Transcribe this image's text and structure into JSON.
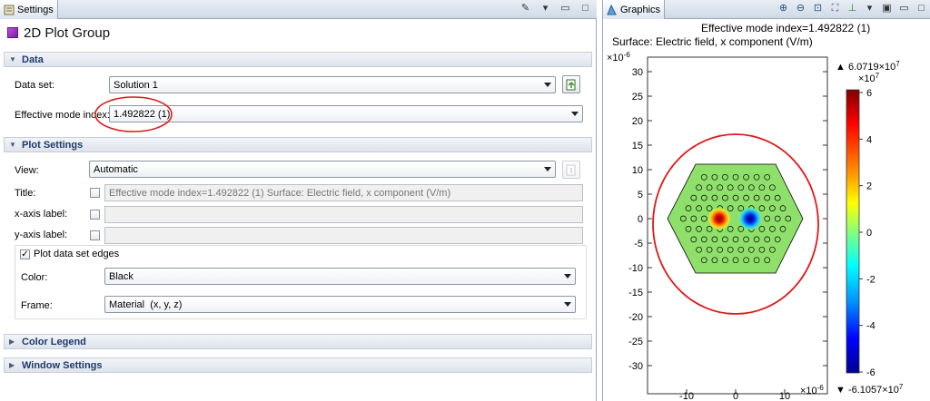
{
  "settings": {
    "tab_label": "Settings",
    "header_title": "2D Plot Group",
    "data_section": {
      "title": "Data",
      "dataset_label": "Data set:",
      "dataset_value": "Solution 1",
      "mode_index_label": "Effective mode index:",
      "mode_index_value": "1.492822 (1)"
    },
    "plot_settings": {
      "title": "Plot Settings",
      "view_label": "View:",
      "view_value": "Automatic",
      "title_label": "Title:",
      "title_value": "Effective mode index=1.492822 (1) Surface: Electric field, x component (V/m)",
      "xaxis_label": "x-axis label:",
      "xaxis_value": "",
      "yaxis_label": "y-axis label:",
      "yaxis_value": "",
      "edges_label": "Plot data set edges",
      "edges_checked": true,
      "color_label": "Color:",
      "color_value": "Black",
      "frame_label": "Frame:",
      "frame_value": "Material  (x, y, z)"
    },
    "color_legend_title": "Color Legend",
    "window_settings_title": "Window Settings"
  },
  "graphics": {
    "tab_label": "Graphics",
    "plot_title_line1": "Effective mode index=1.492822 (1)",
    "plot_title_line2": "Surface: Electric field, x component (V/m)",
    "y_exponent": "×10",
    "y_exponent_power": "-6",
    "x_exponent": "×10",
    "x_exponent_power": "-6",
    "y_ticks": [
      "30",
      "25",
      "20",
      "15",
      "10",
      "5",
      "0",
      "-5",
      "-10",
      "-15",
      "-20",
      "-25",
      "-30"
    ],
    "x_ticks": [
      "-10",
      "0",
      "10"
    ],
    "colorbar": {
      "max_label": "6.0719×10",
      "max_power": "7",
      "scale_label": "×10",
      "scale_power": "7",
      "ticks": [
        "6",
        "4",
        "2",
        "0",
        "-2",
        "-4",
        "-6"
      ],
      "min_label": "-6.1057×10",
      "min_power": "7"
    },
    "colors": {
      "field_green": "#8fe06a",
      "hot_red": "#d40000",
      "cold_blue": "#0010c0",
      "annotation_red": "#e01818"
    }
  }
}
